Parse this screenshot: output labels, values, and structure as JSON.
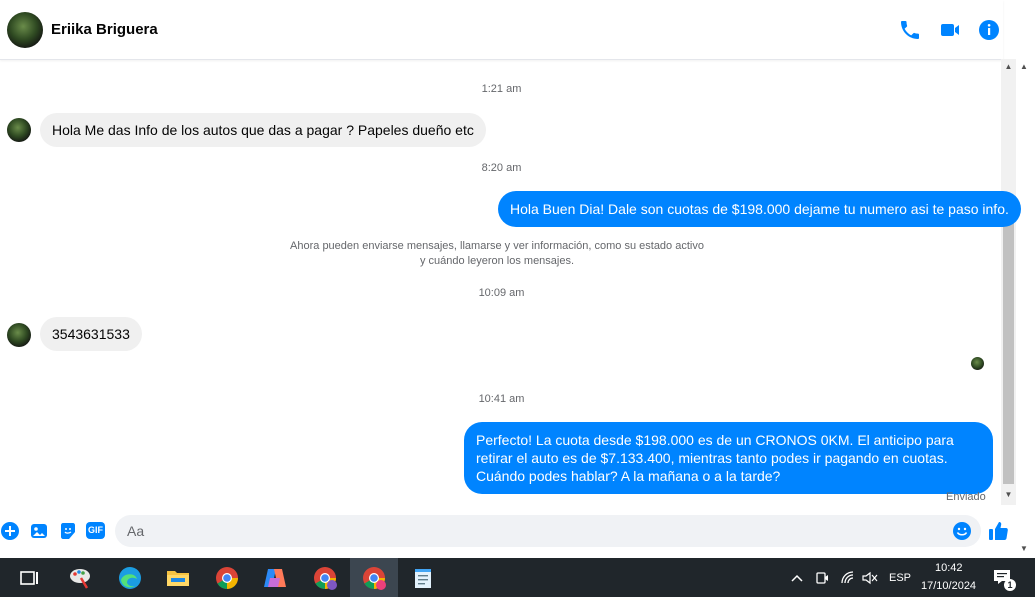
{
  "header": {
    "contact_name": "Eriika Briguera",
    "icons": [
      "phone-icon",
      "video-camera-icon",
      "info-icon"
    ]
  },
  "colors": {
    "accent": "#0084ff",
    "incoming_bubble": "#f0f0f0",
    "taskbar": "#20262b"
  },
  "messages": [
    {
      "timestamp": "1:21 am"
    },
    {
      "direction": "incoming",
      "text": "Hola Me das Info de los autos que das a pagar ? Papeles dueño etc"
    },
    {
      "timestamp": "8:20 am"
    },
    {
      "direction": "outgoing",
      "text": "Hola Buen Dia! Dale son cuotas de $198.000 dejame tu numero asi te paso info."
    },
    {
      "notice_line1": "Ahora pueden enviarse mensajes, llamarse y ver información, como su estado activo",
      "notice_line2": "y cuándo leyeron los mensajes."
    },
    {
      "timestamp": "10:09 am"
    },
    {
      "direction": "incoming",
      "text": "3543631533"
    },
    {
      "timestamp": "10:41 am"
    },
    {
      "direction": "outgoing",
      "text": "Perfecto! La cuota desde $198.000 es de un CRONOS 0KM. El anticipo para retirar el auto es de $7.133.400, mientras tanto podes ir pagando en cuotas. Cuándo podes hablar? A la mañana o a la tarde?"
    }
  ],
  "message_status": "Enviado",
  "composer": {
    "placeholder": "Aa",
    "value": "",
    "icons": [
      "plus-icon",
      "image-icon",
      "sticker-icon",
      "gif-icon",
      "emoji-icon",
      "like-icon"
    ],
    "gif_label": "GIF"
  },
  "taskbar": {
    "apps": [
      "task-view-icon",
      "paint-icon",
      "edge-icon",
      "file-explorer-icon",
      "chrome-icon",
      "copilot-icon",
      "chrome-profile-icon",
      "chrome-profile-active-icon",
      "notepad-icon"
    ],
    "tray": {
      "language": "ESP",
      "time": "10:42",
      "date": "17/10/2024",
      "notification_count": "1"
    }
  }
}
